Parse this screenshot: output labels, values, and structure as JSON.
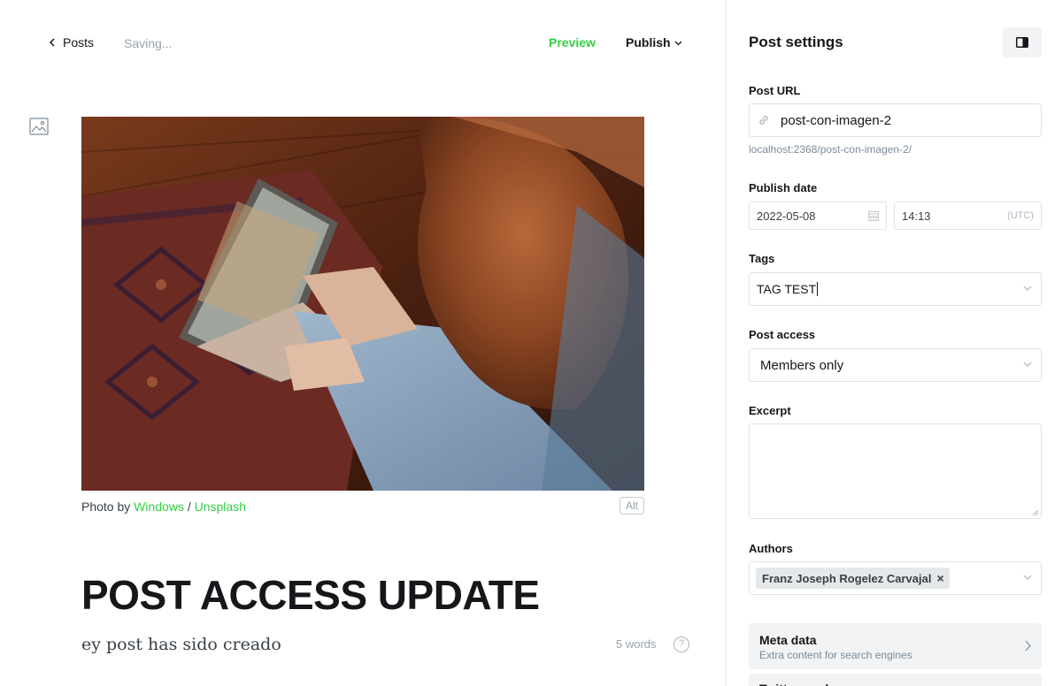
{
  "editor": {
    "back_label": "Posts",
    "status": "Saving...",
    "preview_label": "Preview",
    "publish_label": "Publish",
    "caption_prefix": "Photo by ",
    "caption_author": "Windows",
    "caption_sep": " / ",
    "caption_source": "Unsplash",
    "alt_label": "Alt",
    "title": "POST ACCESS UPDATE",
    "body": "ey post has sido creado",
    "word_count": "5 words",
    "help_label": "?",
    "colors": {
      "accent": "#30cf43",
      "text": "#15171a",
      "muted": "#99a3ad"
    }
  },
  "settings": {
    "title": "Post settings",
    "post_url_label": "Post URL",
    "post_url_value": "post-con-imagen-2",
    "post_url_hint": "localhost:2368/post-con-imagen-2/",
    "publish_date_label": "Publish date",
    "date_value": "2022-05-08",
    "time_value": "14:13",
    "timezone": "(UTC)",
    "tags_label": "Tags",
    "tags_value": "TAG TEST",
    "post_access_label": "Post access",
    "post_access_value": "Members only",
    "excerpt_label": "Excerpt",
    "excerpt_value": "",
    "authors_label": "Authors",
    "author_name": "Franz Joseph Rogelez Carvajal",
    "author_remove": "×",
    "meta_title": "Meta data",
    "meta_subtitle": "Extra content for search engines",
    "next_row_label": "Twitter card"
  }
}
